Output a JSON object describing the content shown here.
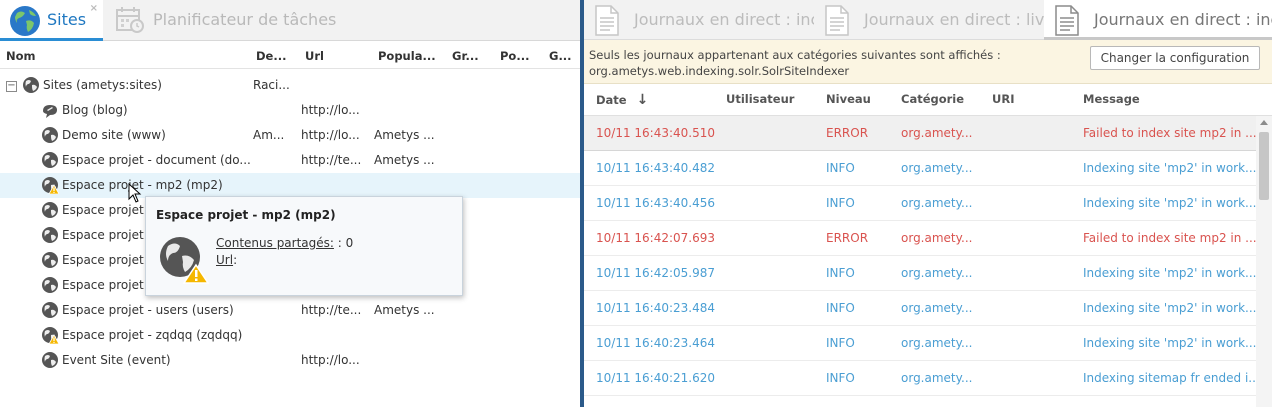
{
  "left_panel": {
    "tabs": [
      {
        "label": "Sites",
        "active": true,
        "has_close": true,
        "close_glyph": "×"
      },
      {
        "label": "Planificateur de tâches",
        "active": false
      }
    ],
    "columns": [
      "Nom",
      "De...",
      "Url",
      "Popula...",
      "Gr...",
      "Po...",
      "G..."
    ],
    "root": {
      "name": "Sites (ametys:sites)",
      "de": "Raci...",
      "expander": "−"
    },
    "rows": [
      {
        "name": "Blog (blog)",
        "de": "",
        "url": "http://lo...",
        "popula": "",
        "icon": "blog-icon"
      },
      {
        "name": "Demo site (www)",
        "de": "Am...",
        "url": "http://lo...",
        "popula": "Ametys ...",
        "icon": "globe-icon"
      },
      {
        "name": "Espace projet - document (do...",
        "de": "",
        "url": "http://te...",
        "popula": "Ametys ...",
        "icon": "globe-icon"
      },
      {
        "name": "Espace projet - mp2 (mp2)",
        "de": "",
        "url": "",
        "popula": "",
        "icon": "globe-warning-icon",
        "highlighted": true
      },
      {
        "name": "Espace projet -",
        "de": "",
        "url": "",
        "popula": "",
        "icon": "globe-icon"
      },
      {
        "name": "Espace projet -",
        "de": "",
        "url": "",
        "popula": "",
        "icon": "globe-icon"
      },
      {
        "name": "Espace projet -",
        "de": "",
        "url": "",
        "popula": "",
        "icon": "globe-icon"
      },
      {
        "name": "Espace projet -",
        "de": "",
        "url": "",
        "popula": "",
        "icon": "globe-icon"
      },
      {
        "name": "Espace projet - users (users)",
        "de": "",
        "url": "http://te...",
        "popula": "Ametys ...",
        "icon": "globe-icon"
      },
      {
        "name": "Espace projet - zqdqq (zqdqq)",
        "de": "",
        "url": "",
        "popula": "",
        "icon": "globe-warning-icon"
      },
      {
        "name": "Event Site (event)",
        "de": "",
        "url": "http://lo...",
        "popula": "",
        "icon": "globe-icon"
      }
    ],
    "tooltip": {
      "title": "Espace projet - mp2 (mp2)",
      "line1_label": "Contenus partagés:",
      "line1_value": " : 0",
      "line2_label": "Url",
      "line2_value": ":"
    }
  },
  "right_panel": {
    "tabs": [
      {
        "label": "Journaux en direct : inc",
        "active": false
      },
      {
        "label": "Journaux en direct : liv",
        "active": false
      },
      {
        "label": "Journaux en direct : inc",
        "active": true
      }
    ],
    "info_message_line1": "Seuls les journaux appartenant aux catégories suivantes sont affichés :",
    "info_message_line2": "org.ametys.web.indexing.solr.SolrSiteIndexer",
    "config_button": "Changer la configuration",
    "columns": [
      "Date",
      "Utilisateur",
      "Niveau",
      "Catégorie",
      "URI",
      "Message"
    ],
    "sort_glyph": "↓",
    "logs": [
      {
        "date": "10/11 16:43:40.510",
        "user": "",
        "level": "ERROR",
        "category": "org.amety...",
        "uri": "",
        "message": "Failed to index site mp2 in ..."
      },
      {
        "date": "10/11 16:43:40.482",
        "user": "",
        "level": "INFO",
        "category": "org.amety...",
        "uri": "",
        "message": "Indexing site 'mp2' in work..."
      },
      {
        "date": "10/11 16:43:40.456",
        "user": "",
        "level": "INFO",
        "category": "org.amety...",
        "uri": "",
        "message": "Indexing site 'mp2' in work..."
      },
      {
        "date": "10/11 16:42:07.693",
        "user": "",
        "level": "ERROR",
        "category": "org.amety...",
        "uri": "",
        "message": "Failed to index site mp2 in ..."
      },
      {
        "date": "10/11 16:42:05.987",
        "user": "",
        "level": "INFO",
        "category": "org.amety...",
        "uri": "",
        "message": "Indexing site 'mp2' in work..."
      },
      {
        "date": "10/11 16:40:23.484",
        "user": "",
        "level": "INFO",
        "category": "org.amety...",
        "uri": "",
        "message": "Indexing site 'mp2' in work..."
      },
      {
        "date": "10/11 16:40:23.464",
        "user": "",
        "level": "INFO",
        "category": "org.amety...",
        "uri": "",
        "message": "Indexing site 'mp2' in work..."
      },
      {
        "date": "10/11 16:40:21.620",
        "user": "",
        "level": "INFO",
        "category": "org.amety...",
        "uri": "",
        "message": "Indexing sitemap fr ended i..."
      }
    ]
  },
  "colors": {
    "accent": "#2a8dd4",
    "splitter": "#2b5a8a",
    "info_text": "#4a9ed3",
    "error_text": "#d9534f",
    "infobar_bg": "#fbf5e2"
  }
}
